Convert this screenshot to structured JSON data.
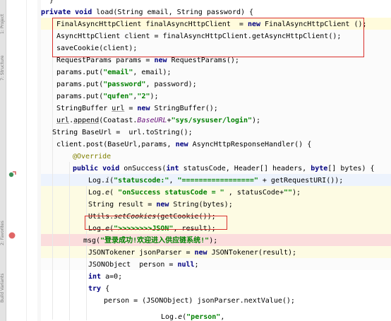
{
  "sidebar": {
    "tabs": [
      "1: Project",
      "7: Structure",
      "2: Favorites",
      "Build Variants"
    ]
  },
  "code_lines": [
    {
      "indent": 8,
      "text": "}"
    },
    {
      "indent": 4,
      "text": "private void load(String email, String password) {"
    },
    {
      "indent": 8,
      "text": "FinalAsyncHttpClient finalAsyncHttpClient  = new FinalAsyncHttpClient ();"
    },
    {
      "indent": 8,
      "text": "AsyncHttpClient client = finalAsyncHttpClient.getAsyncHttpClient();"
    },
    {
      "indent": 8,
      "text": "saveCookie(client);"
    },
    {
      "indent": 8,
      "text": "RequestParams params = new RequestParams();"
    },
    {
      "indent": 8,
      "text": "params.put(\"email\", email);"
    },
    {
      "indent": 8,
      "text": "params.put(\"password\", password);"
    },
    {
      "indent": 8,
      "text": "params.put(\"qufen\",\"2\");"
    },
    {
      "indent": 8,
      "text": "StringBuffer url = new StringBuffer();"
    },
    {
      "indent": 8,
      "text": "url.append(Coatast.BaseURL+\"sys/sysuser/login\");"
    },
    {
      "indent": 6,
      "text": "String BaseUrl =  url.toString();"
    },
    {
      "indent": 8,
      "text": "client.post(BaseUrl,params, new AsyncHttpResponseHandler() {"
    },
    {
      "indent": 12,
      "text": "@Override"
    },
    {
      "indent": 12,
      "text": "public void onSuccess(int statusCode, Header[] headers, byte[] bytes) {"
    },
    {
      "indent": 16,
      "text": "Log.i(\"statuscode:\", \"=================\" + getRequestURI());"
    },
    {
      "indent": 16,
      "text": "Log.e( \"onSuccess statusCode = \" , statusCode+\"\");"
    },
    {
      "indent": 16,
      "text": "String result = new String(bytes);"
    },
    {
      "indent": 16,
      "text": "Utils.setCookies(getCookie());"
    },
    {
      "indent": 16,
      "text": "Log.e(\">>>>>>>>JSON\", result);"
    },
    {
      "indent": 15,
      "text": "msg(\"登录成功!欢迎进入供应链系统!\");"
    },
    {
      "indent": 16,
      "text": "JSONTokener jsonParser = new JSONTokener(result);"
    },
    {
      "indent": 16,
      "text": "JSONObject  person = null;"
    },
    {
      "indent": 16,
      "text": "int a=0;"
    },
    {
      "indent": 16,
      "text": "try {"
    },
    {
      "indent": 20,
      "text": "person = (JSONObject) jsonParser.nextValue();"
    },
    {
      "indent": 28,
      "text": "Log.e(\"person\","
    }
  ],
  "colors": {
    "keyword": "#000080",
    "string": "#008000",
    "annotation": "#808000",
    "field": "#660e7a",
    "red_box": "#d9302c",
    "breakpoint": "#e06666"
  },
  "icons": {
    "override_marker": "override-icon",
    "breakpoint": "breakpoint-icon"
  }
}
